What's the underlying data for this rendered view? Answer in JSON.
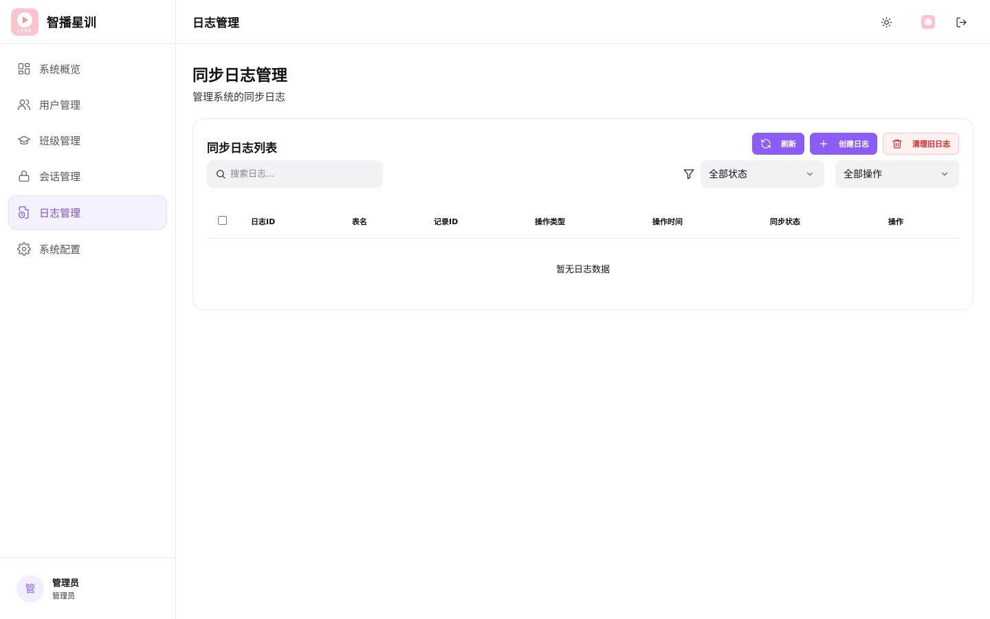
{
  "brand": {
    "name": "智播星训",
    "logo_text": "LIVE"
  },
  "sidebar": {
    "items": [
      {
        "label": "系统概览",
        "icon": "dashboard-icon",
        "active": false
      },
      {
        "label": "用户管理",
        "icon": "users-icon",
        "active": false
      },
      {
        "label": "班级管理",
        "icon": "graduation-cap-icon",
        "active": false
      },
      {
        "label": "会话管理",
        "icon": "lock-icon",
        "active": false
      },
      {
        "label": "日志管理",
        "icon": "file-clock-icon",
        "active": true
      },
      {
        "label": "系统配置",
        "icon": "gear-icon",
        "active": false
      }
    ]
  },
  "user": {
    "avatar_text": "管",
    "name": "管理员",
    "role": "管理员"
  },
  "header": {
    "title": "日志管理",
    "icons": [
      "sun-icon",
      "app-logo-icon",
      "logout-icon"
    ]
  },
  "page": {
    "title": "同步日志管理",
    "subtitle": "管理系统的同步日志"
  },
  "card": {
    "title": "同步日志列表",
    "buttons": {
      "refresh": "刷新",
      "create": "创建日志",
      "clear": "清理旧日志"
    },
    "search_placeholder": "搜索日志...",
    "status_filter": "全部状态",
    "action_filter": "全部操作",
    "columns": [
      "日志ID",
      "表名",
      "记录ID",
      "操作类型",
      "操作时间",
      "同步状态",
      "操作"
    ],
    "empty_text": "暂无日志数据"
  },
  "colors": {
    "accent": "#8b5cf6",
    "danger": "#dc2626",
    "logo": "#ffc3cd"
  }
}
